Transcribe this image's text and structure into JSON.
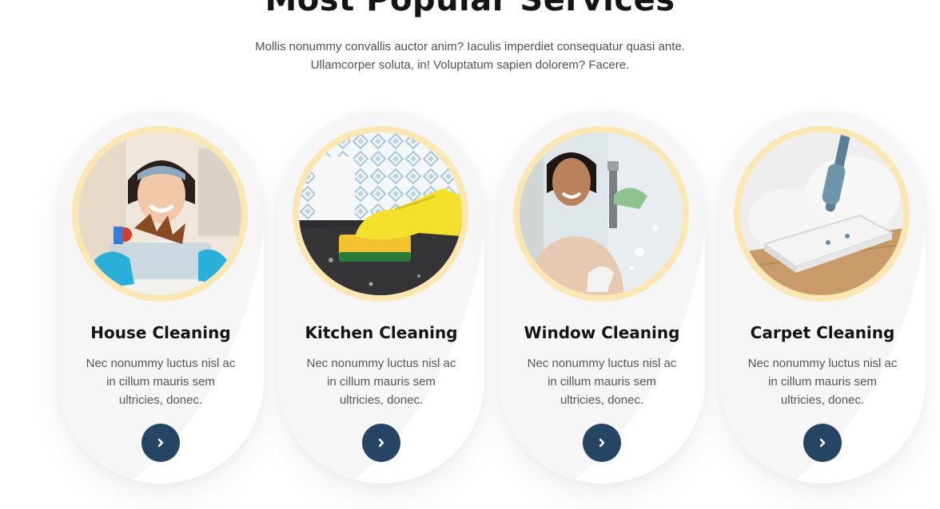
{
  "section": {
    "title": "Most Popular Services",
    "description": "Mollis nonummy convallis auctor anim? Iaculis imperdiet consequatur quasi ante. Ullamcorper soluta, in! Voluptatum sapien dolorem? Facere."
  },
  "colors": {
    "accent_ring": "#fbe7b3",
    "button": "#264565",
    "card_bg": "#f6f6f6"
  },
  "services": [
    {
      "title": "House Cleaning",
      "description": "Nec nonummy luctus nisl ac in cillum mauris sem ultricies, donec.",
      "image": "woman-holding-cleaning-supplies-photo",
      "button_icon": "chevron-right-icon"
    },
    {
      "title": "Kitchen Cleaning",
      "description": "Nec nonummy luctus nisl ac in cillum mauris sem ultricies, donec.",
      "image": "gloved-hand-scrubbing-countertop-photo",
      "button_icon": "chevron-right-icon"
    },
    {
      "title": "Window Cleaning",
      "description": "Nec nonummy luctus nisl ac in cillum mauris sem ultricies, donec.",
      "image": "woman-squeegee-window-photo",
      "button_icon": "chevron-right-icon"
    },
    {
      "title": "Carpet Cleaning",
      "description": "Nec nonummy luctus nisl ac in cillum mauris sem ultricies, donec.",
      "image": "steam-mop-on-floor-photo",
      "button_icon": "chevron-right-icon"
    }
  ]
}
